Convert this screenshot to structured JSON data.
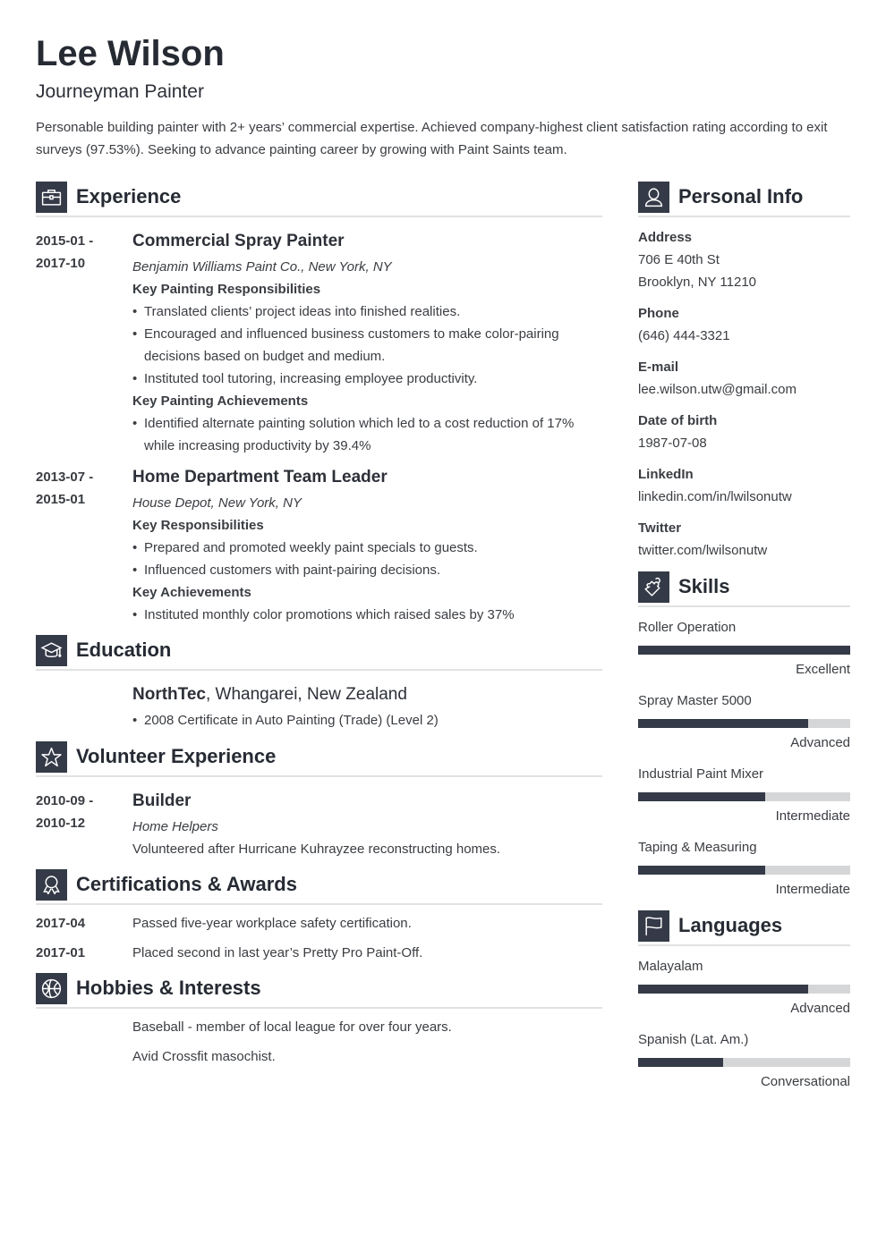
{
  "header": {
    "name": "Lee Wilson",
    "title": "Journeyman Painter",
    "summary": "Personable building painter with 2+ years’ commercial expertise. Achieved company-highest client satisfaction rating according to exit surveys (97.53%). Seeking to advance painting career by growing with Paint Saints team."
  },
  "experience": {
    "heading": "Experience",
    "icon": "briefcase-icon",
    "jobs": [
      {
        "date_start": "2015-01 -",
        "date_end": "2017-10",
        "title": "Commercial Spray Painter",
        "company": "Benjamin Williams Paint Co., New York, NY",
        "resp_heading": "Key Painting Responsibilities",
        "responsibilities": [
          "Translated clients’ project ideas into finished realities.",
          "Encouraged and influenced business customers to make color-pairing decisions based on budget and medium.",
          "Instituted tool tutoring, increasing employee productivity."
        ],
        "ach_heading": "Key Painting Achievements",
        "achievements": [
          "Identified alternate painting solution which led to a cost reduction of 17% while increasing productivity by 39.4%"
        ]
      },
      {
        "date_start": "2013-07 -",
        "date_end": "2015-01",
        "title": "Home Department Team Leader",
        "company": "House Depot, New York, NY",
        "resp_heading": "Key Responsibilities",
        "responsibilities": [
          "Prepared and promoted weekly paint specials to guests.",
          "Influenced customers with paint-pairing decisions."
        ],
        "ach_heading": "Key Achievements",
        "achievements": [
          "Instituted monthly color promotions which raised sales by 37%"
        ]
      }
    ]
  },
  "education": {
    "heading": "Education",
    "icon": "graduation-cap-icon",
    "school": "NorthTec",
    "location": ", Whangarei, New Zealand",
    "items": [
      "2008 Certificate in Auto Painting (Trade) (Level 2)"
    ]
  },
  "volunteer": {
    "heading": "Volunteer Experience",
    "icon": "star-icon",
    "date_start": "2010-09 -",
    "date_end": "2010-12",
    "title": "Builder",
    "org": "Home Helpers",
    "description": "Volunteered after Hurricane Kuhrayzee reconstructing homes."
  },
  "certifications": {
    "heading": "Certifications & Awards",
    "icon": "award-ribbon-icon",
    "items": [
      {
        "date": "2017-04",
        "text": "Passed five-year workplace safety certification."
      },
      {
        "date": "2017-01",
        "text": "Placed second in last year’s Pretty Pro Paint-Off."
      }
    ]
  },
  "hobbies": {
    "heading": "Hobbies & Interests",
    "icon": "basketball-icon",
    "items": [
      "Baseball - member of local league for over four years.",
      "Avid Crossfit masochist."
    ]
  },
  "personal": {
    "heading": "Personal Info",
    "icon": "person-icon",
    "address_label": "Address",
    "address_line1": "706 E 40th St",
    "address_line2": "Brooklyn, NY 11210",
    "phone_label": "Phone",
    "phone": "(646) 444-3321",
    "email_label": "E-mail",
    "email": "lee.wilson.utw@gmail.com",
    "dob_label": "Date of birth",
    "dob": "1987-07-08",
    "linkedin_label": "LinkedIn",
    "linkedin": "linkedin.com/in/lwilsonutw",
    "twitter_label": "Twitter",
    "twitter": "twitter.com/lwilsonutw"
  },
  "skills": {
    "heading": "Skills",
    "icon": "puzzle-piece-icon",
    "items": [
      {
        "name": "Roller Operation",
        "level": "Excellent",
        "percent": 100
      },
      {
        "name": "Spray Master 5000",
        "level": "Advanced",
        "percent": 80
      },
      {
        "name": "Industrial Paint Mixer",
        "level": "Intermediate",
        "percent": 60
      },
      {
        "name": "Taping & Measuring",
        "level": "Intermediate",
        "percent": 60
      }
    ]
  },
  "languages": {
    "heading": "Languages",
    "icon": "flag-icon",
    "items": [
      {
        "name": "Malayalam",
        "level": "Advanced",
        "percent": 80
      },
      {
        "name": "Spanish (Lat. Am.)",
        "level": "Conversational",
        "percent": 40
      }
    ]
  },
  "colors": {
    "accent": "#343a47",
    "bar_track": "#d5d6d7",
    "text": "#3a3d42",
    "heading": "#262a33"
  }
}
